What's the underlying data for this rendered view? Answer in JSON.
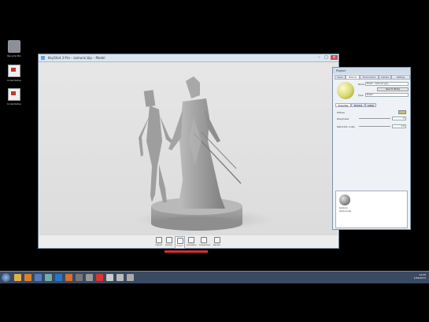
{
  "desktop": {
    "icons": [
      {
        "label": "Recycle Bin",
        "icon": "recycle-bin-icon"
      },
      {
        "label": "CodecSetup",
        "icon": "file-icon"
      },
      {
        "label": "CodecSetup",
        "icon": "file-icon"
      }
    ]
  },
  "app_window": {
    "title": "KeyShot 3 Pro – samurai.bip – Model",
    "toolbar": [
      {
        "label": "Import",
        "icon": "import-icon"
      },
      {
        "label": "Library",
        "icon": "library-icon"
      },
      {
        "label": "Project",
        "icon": "project-icon"
      },
      {
        "label": "Animation",
        "icon": "animation-icon"
      },
      {
        "label": "Screenshot",
        "icon": "camera-icon"
      },
      {
        "label": "Render",
        "icon": "render-icon"
      }
    ],
    "active_toolbar_index": 2
  },
  "material_panel": {
    "title": "Project",
    "tabs": [
      "Scene",
      "Material",
      "Environment",
      "Camera",
      "Settings"
    ],
    "selected_tab": 1,
    "name_label": "Name",
    "name_value": "Plastic - textured grey",
    "save_label": "Save to library",
    "type_label": "Type",
    "type_value": "Plastic",
    "subtabs": [
      "Properties",
      "Textures",
      "Labels"
    ],
    "properties": [
      {
        "label": "Diffuse",
        "kind": "color",
        "color": "#bfc275"
      },
      {
        "label": "Roughness",
        "kind": "value",
        "value": "0"
      },
      {
        "label": "Refraction Index",
        "kind": "value",
        "value": "1.5"
      }
    ],
    "library_item": {
      "name": "Samurai",
      "sub": "Samurai.bip"
    }
  },
  "taskbar": {
    "time": "12:45",
    "date": "1/26/2013",
    "apps": [
      {
        "icon": "explorer-icon",
        "color": "#e0b04a"
      },
      {
        "icon": "media-player-icon",
        "color": "#d9822b"
      },
      {
        "icon": "network-icon",
        "color": "#4f7fbf"
      },
      {
        "icon": "app-icon",
        "color": "#7aa"
      },
      {
        "icon": "photoshop-icon",
        "color": "#27c"
      },
      {
        "icon": "firefox-icon",
        "color": "#d86f2b"
      },
      {
        "icon": "app2-icon",
        "color": "#777"
      },
      {
        "icon": "app3-icon",
        "color": "#999"
      },
      {
        "icon": "keyshot-icon",
        "color": "#d33"
      },
      {
        "icon": "app4-icon",
        "color": "#ccc"
      },
      {
        "icon": "app5-icon",
        "color": "#bbb"
      },
      {
        "icon": "app6-icon",
        "color": "#aaa"
      }
    ]
  }
}
